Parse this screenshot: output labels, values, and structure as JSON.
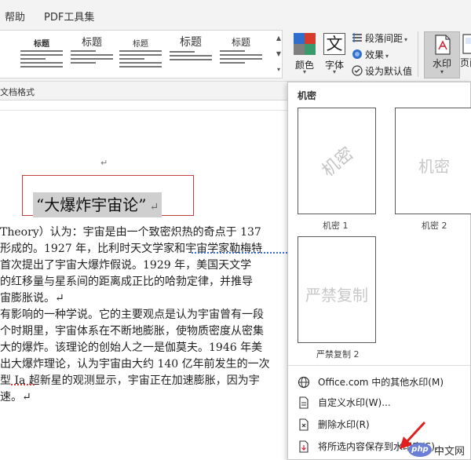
{
  "menu": {
    "tab_help": "帮助",
    "tab_pdf": "PDF工具集"
  },
  "ribbon": {
    "style_gallery": [
      {
        "title": "标题"
      },
      {
        "title": "标题"
      },
      {
        "title": "标题"
      },
      {
        "title": "标题"
      },
      {
        "title": "标题"
      },
      {
        "title": "标题"
      }
    ],
    "colors_label": "颜色",
    "font_label": "字体",
    "paragraph_spacing_label": "段落间距",
    "effects_label": "效果",
    "set_default_label": "设为默认值",
    "watermark_label": "水印",
    "page_color_label": "页面",
    "group_label": "文档格式",
    "colors": {
      "blue": "#2f6fcb",
      "red": "#d63b2b",
      "gray": "#7f7f7f",
      "teal": "#3a9a6b"
    }
  },
  "document": {
    "title": "“大爆炸宇宙论”",
    "lines": [
      "Theory）认为：宇宙是由一个致密炽热的奇点于 137",
      "形成的。1927 年，比利时天文学家和宇宙学家勒梅特",
      "  首次提出了宇宙大爆炸假说。1929 年，美国天文学",
      "的红移量与星系间的距离成正比的哈勃定律，并推导",
      "宙膨胀说。↵",
      "有影响的一种学说。它的主要观点是认为宇宙曾有一段",
      "个时期里，宇宙体系在不断地膨胀，使物质密度从密集",
      "大的爆炸。该理论的创始人之一是伽莫夫。1946 年美",
      "出大爆炸理论，认为宇宙由大约 140 亿年前发生的一次",
      "型 Ia 超新星的观测显示，宇宙正在加速膨胀，因为宇",
      "速。↵"
    ]
  },
  "watermark_menu": {
    "header": "机密",
    "gallery": [
      {
        "caption": "机密 1",
        "text": "机密",
        "style": "diagonal"
      },
      {
        "caption": "机密 2",
        "text": "机密",
        "style": "horizontal"
      },
      {
        "caption": "严禁复制 2",
        "text": "严禁复制",
        "style": "horizontal"
      }
    ],
    "items": [
      {
        "label": "Office.com 中的其他水印(M)",
        "icon": "globe-icon"
      },
      {
        "label": "自定义水印(W)...",
        "icon": "page-icon"
      },
      {
        "label": "删除水印(R)",
        "icon": "remove-watermark-icon"
      },
      {
        "label": "将所选内容保存到水印库(S)...",
        "icon": "save-selection-icon"
      }
    ]
  },
  "logo": {
    "brand": "php",
    "suffix": "中文网"
  }
}
